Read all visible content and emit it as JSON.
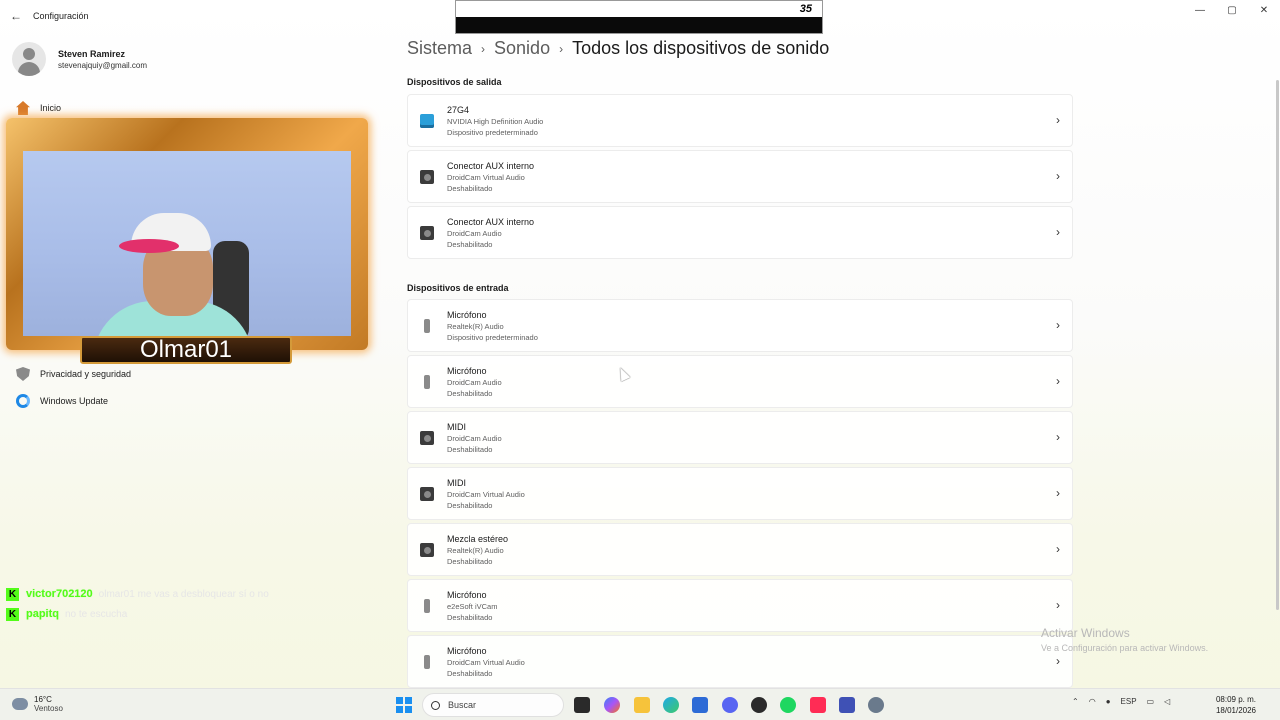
{
  "app": {
    "title": "Configuración"
  },
  "window_controls": {
    "minimize": "—",
    "maximize": "▢",
    "close": "✕"
  },
  "banner": {
    "number": "35"
  },
  "user": {
    "name": "Steven Ramirez",
    "email": "stevenajquiy@gmail.com"
  },
  "sidebar": {
    "items": [
      {
        "label": "Inicio",
        "icon": "home-icon"
      },
      {
        "label": "Privacidad y seguridad",
        "icon": "shield-icon"
      },
      {
        "label": "Windows Update",
        "icon": "update-icon"
      }
    ]
  },
  "webcam": {
    "nameplate": "Olmar01"
  },
  "chat": [
    {
      "badge": "K",
      "user": "victor702120",
      "message": "olmar01 me vas a desbloquear sí o no"
    },
    {
      "badge": "K",
      "user": "papitq",
      "message": "no te escucha"
    }
  ],
  "breadcrumb": {
    "level1": "Sistema",
    "level2": "Sonido",
    "current": "Todos los dispositivos de sonido",
    "separator": "›"
  },
  "sections": {
    "output": "Dispositivos de salida",
    "input": "Dispositivos de entrada"
  },
  "output_devices": [
    {
      "name": "27G4",
      "driver": "NVIDIA High Definition Audio",
      "status": "Dispositivo predeterminado",
      "icon": "monitor-icon"
    },
    {
      "name": "Conector AUX interno",
      "driver": "DroidCam Virtual Audio",
      "status": "Deshabilitado",
      "icon": "speaker-icon"
    },
    {
      "name": "Conector AUX interno",
      "driver": "DroidCam Audio",
      "status": "Deshabilitado",
      "icon": "speaker-icon"
    }
  ],
  "input_devices": [
    {
      "name": "Micrófono",
      "driver": "Realtek(R) Audio",
      "status": "Dispositivo predeterminado",
      "icon": "microphone-icon"
    },
    {
      "name": "Micrófono",
      "driver": "DroidCam Audio",
      "status": "Deshabilitado",
      "icon": "microphone-icon"
    },
    {
      "name": "MIDI",
      "driver": "DroidCam Audio",
      "status": "Deshabilitado",
      "icon": "speaker-icon"
    },
    {
      "name": "MIDI",
      "driver": "DroidCam Virtual Audio",
      "status": "Deshabilitado",
      "icon": "speaker-icon"
    },
    {
      "name": "Mezcla estéreo",
      "driver": "Realtek(R) Audio",
      "status": "Deshabilitado",
      "icon": "speaker-icon"
    },
    {
      "name": "Micrófono",
      "driver": "e2eSoft iVCam",
      "status": "Deshabilitado",
      "icon": "microphone-icon"
    },
    {
      "name": "Micrófono",
      "driver": "DroidCam Virtual Audio",
      "status": "Deshabilitado",
      "icon": "microphone-icon"
    }
  ],
  "watermark": {
    "title": "Activar Windows",
    "subtitle": "Ve a Configuración para activar Windows."
  },
  "taskbar": {
    "weather_temp": "16°C",
    "weather_desc": "Ventoso",
    "search_placeholder": "Buscar",
    "language": "ESP",
    "time": "08:09 p. m.",
    "date": "18/01/2026",
    "apps": [
      "file-explorer-icon",
      "copilot-icon",
      "folder-icon",
      "edge-icon",
      "store-icon",
      "discord-icon",
      "obs-icon",
      "spotify-icon",
      "tiktok-icon",
      "app-icon",
      "settings-icon"
    ]
  },
  "colors": {
    "accent": "#1a8ff0",
    "kick_green": "#53fc18"
  }
}
